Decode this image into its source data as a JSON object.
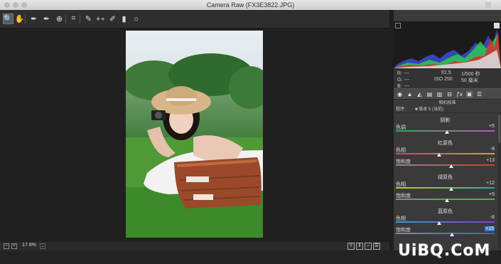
{
  "window": {
    "title": "Camera Raw (FX3E3822.JPG)"
  },
  "toolbar": {
    "tools": [
      {
        "name": "zoom-icon",
        "glyph": "🔍"
      },
      {
        "name": "hand-icon",
        "glyph": "✋"
      },
      {
        "name": "eyedropper-icon",
        "glyph": "✒"
      },
      {
        "name": "color-sampler-icon",
        "glyph": "✒"
      },
      {
        "name": "target-adjustment-icon",
        "glyph": "⊕"
      },
      {
        "name": "crop-icon",
        "glyph": "⌗"
      },
      {
        "name": "spot-removal-icon",
        "glyph": "✎"
      },
      {
        "name": "red-eye-icon",
        "glyph": "+∘"
      },
      {
        "name": "adjustment-brush-icon",
        "glyph": "✐"
      },
      {
        "name": "graduated-filter-icon",
        "glyph": "▮"
      },
      {
        "name": "radial-filter-icon",
        "glyph": "○"
      }
    ]
  },
  "status": {
    "zoom": "17.8%",
    "zoom_out": "−",
    "zoom_in": "+",
    "dropdown": "⌄"
  },
  "view_buttons": [
    "Y",
    "⇕",
    "⇔",
    "☰"
  ],
  "info": {
    "r_label": "R:",
    "g_label": "G:",
    "b_label": "B:",
    "r": "---",
    "g": "---",
    "b": "---",
    "aperture": "f/2.5",
    "shutter": "1/500 秒",
    "iso": "ISO 250",
    "focal": "50 毫米"
  },
  "tabs": [
    "◉",
    "▲",
    "◭",
    "▤",
    "▥",
    "⊟",
    "ƒx",
    "◙",
    "☰"
  ],
  "panel": {
    "subheader": "相机校准",
    "mode_label": "程序:",
    "mode_value": "■ 版本 5 (当前)",
    "sections": [
      {
        "title": "阴影",
        "rows": [
          {
            "label": "色调",
            "value": "+5",
            "pos": 0.52,
            "track": "tint"
          }
        ]
      },
      {
        "title": "红原色",
        "rows": [
          {
            "label": "色相",
            "value": "-8",
            "pos": 0.44,
            "track": "red_hue"
          },
          {
            "label": "饱和度",
            "value": "+13",
            "pos": 0.56,
            "track": "red_sat"
          }
        ]
      },
      {
        "title": "绿原色",
        "rows": [
          {
            "label": "色相",
            "value": "+12",
            "pos": 0.56,
            "track": "green_hue"
          },
          {
            "label": "饱和度",
            "value": "+5",
            "pos": 0.52,
            "track": "green_sat"
          }
        ]
      },
      {
        "title": "蓝原色",
        "rows": [
          {
            "label": "色相",
            "value": "-8",
            "pos": 0.44,
            "track": "blue_hue"
          },
          {
            "label": "饱和度",
            "value": "+15",
            "pos": 0.57,
            "track": "blue_sat",
            "highlight": true
          }
        ]
      }
    ]
  },
  "watermark": "UiBQ.CoM",
  "colors": {
    "tint": "#2fae3a,#c24fd0",
    "red_hue": "#d03a8a,#d6a23a",
    "red_sat": "#8a8a8a,#e03030",
    "green_hue": "#c8c23a,#2fa8a0",
    "green_sat": "#8a8a8a,#2fc23a",
    "blue_hue": "#2fa0c8,#8a3ad0",
    "blue_sat": "#8a8a8a,#3060e0"
  }
}
